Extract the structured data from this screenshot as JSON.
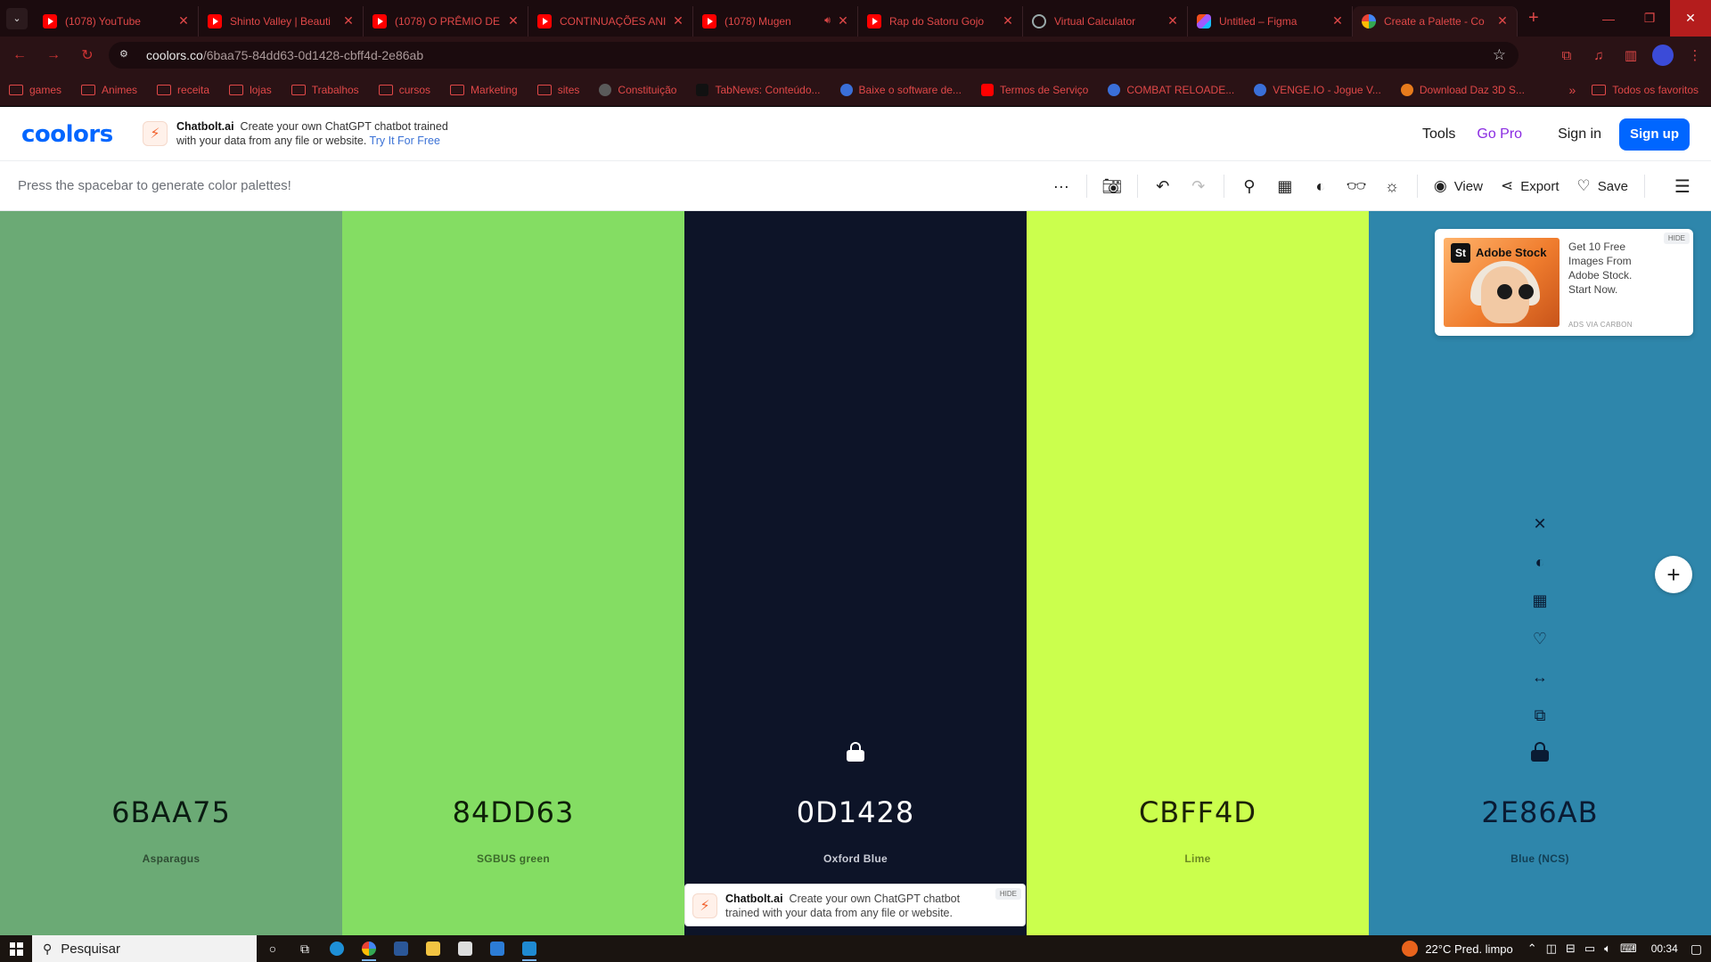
{
  "browser": {
    "tabs": [
      {
        "title": "(1078) YouTube",
        "icon": "youtube-icon",
        "favicon": "yt"
      },
      {
        "title": "Shinto Valley | Beauti",
        "icon": "youtube-icon",
        "favicon": "yt"
      },
      {
        "title": "(1078) O PRÊMIO DE",
        "icon": "youtube-icon",
        "favicon": "yt"
      },
      {
        "title": "CONTINUAÇÕES ANI",
        "icon": "youtube-icon",
        "favicon": "yt"
      },
      {
        "title": "(1078) Mugen",
        "icon": "youtube-icon",
        "favicon": "yt",
        "audio": true
      },
      {
        "title": "Rap do Satoru Gojo",
        "icon": "youtube-icon",
        "favicon": "yt"
      },
      {
        "title": "Virtual Calculator",
        "icon": "globe-icon",
        "favicon": "globe"
      },
      {
        "title": "Untitled – Figma",
        "icon": "figma-icon",
        "favicon": "figma"
      },
      {
        "title": "Create a Palette - Co",
        "icon": "coolors-icon",
        "favicon": "google",
        "active": true
      }
    ],
    "url_host": "coolors.co",
    "url_path": "/6baa75-84dd63-0d1428-cbff4d-2e86ab",
    "bookmarks": [
      {
        "label": "games",
        "type": "folder"
      },
      {
        "label": "Animes",
        "type": "folder"
      },
      {
        "label": "receita",
        "type": "folder"
      },
      {
        "label": "lojas",
        "type": "folder"
      },
      {
        "label": "Trabalhos",
        "type": "folder"
      },
      {
        "label": "cursos",
        "type": "folder"
      },
      {
        "label": "Marketing",
        "type": "folder"
      },
      {
        "label": "sites",
        "type": "folder"
      },
      {
        "label": "Constituição",
        "type": "dot",
        "style": "grey"
      },
      {
        "label": "TabNews: Conteúdo...",
        "type": "dot",
        "style": "black"
      },
      {
        "label": "Baixe o software de...",
        "type": "dot",
        "style": "blue"
      },
      {
        "label": "Termos de Serviço",
        "type": "dot",
        "style": "red"
      },
      {
        "label": "COMBAT RELOADE...",
        "type": "dot",
        "style": "blue"
      },
      {
        "label": "VENGE.IO - Jogue V...",
        "type": "dot",
        "style": "blue"
      },
      {
        "label": "Download Daz 3D S...",
        "type": "dot",
        "style": "orange"
      }
    ],
    "bookmarks_more": "»",
    "all_bookmarks": "Todos os favoritos"
  },
  "header": {
    "logo": "coolors",
    "promo": {
      "brand": "Chatbolt.ai",
      "text": "Create your own ChatGPT chatbot trained with your data from any file or website.",
      "cta": "Try It For Free"
    },
    "nav": {
      "tools": "Tools",
      "go_pro": "Go Pro",
      "sign_in": "Sign in",
      "sign_up": "Sign up"
    }
  },
  "toolbar": {
    "hint": "Press the spacebar to generate color palettes!",
    "view": "View",
    "export": "Export",
    "save": "Save"
  },
  "palette": [
    {
      "hex": "6BAA75",
      "name": "Asparagus",
      "color": "#6BAA75",
      "text_color": "#0a1b12",
      "name_color": "#2f4d34"
    },
    {
      "hex": "84DD63",
      "name": "SGBUS green",
      "color": "#84DD63",
      "text_color": "#0e2008",
      "name_color": "#3c6a2b"
    },
    {
      "hex": "0D1428",
      "name": "Oxford Blue",
      "color": "#0D1428",
      "text_color": "#ffffff",
      "name_color": "#c9ccd6",
      "locked": true
    },
    {
      "hex": "CBFF4D",
      "name": "Lime",
      "color": "#CBFF4D",
      "text_color": "#1b2208",
      "name_color": "#6c8a22"
    },
    {
      "hex": "2E86AB",
      "name": "Blue (NCS)",
      "color": "#2E86AB",
      "text_color": "#0a1b33",
      "name_color": "#123f55",
      "hovered": true
    }
  ],
  "ad": {
    "brand": "Adobe Stock",
    "badge": "St",
    "text": "Get 10 Free Images From Adobe Stock. Start Now.",
    "hide": "HIDE",
    "via": "ADS VIA CARBON"
  },
  "bottom_ad": {
    "brand": "Chatbolt.ai",
    "text": "Create your own ChatGPT chatbot trained with your data from any file or website.",
    "hide": "HIDE"
  },
  "taskbar": {
    "search_placeholder": "Pesquisar",
    "weather": "22°C  Pred. limpo",
    "time": "00:34"
  }
}
